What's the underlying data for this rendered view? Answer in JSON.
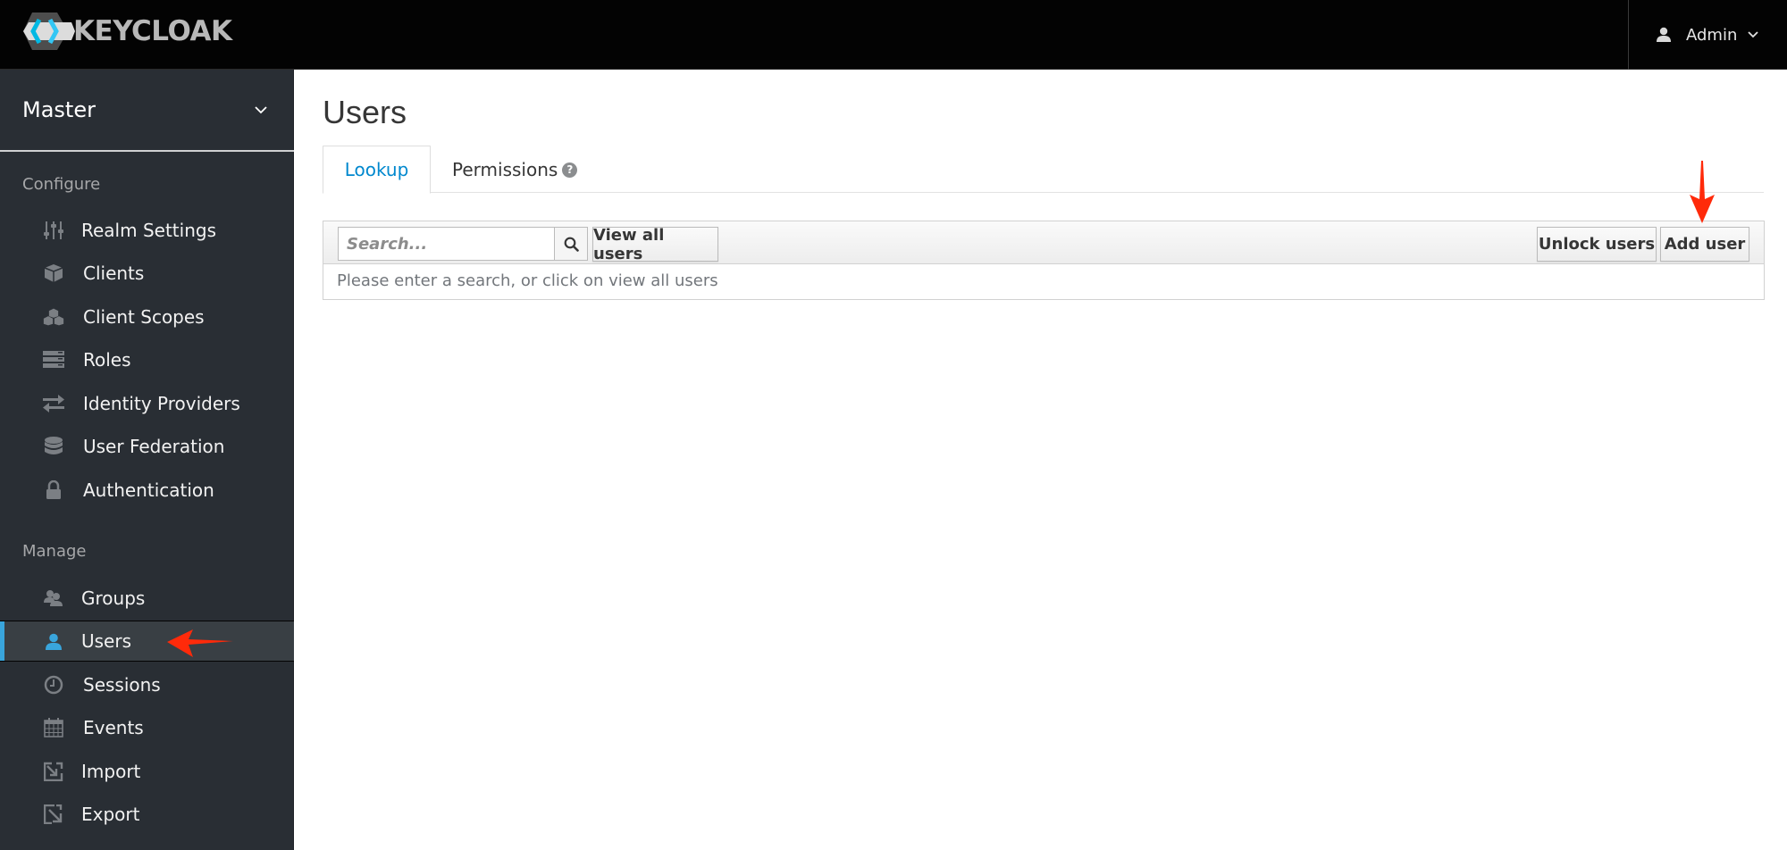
{
  "header": {
    "brand": "KEYCLOAK",
    "user_menu_label": "Admin",
    "icons": {
      "user": "user-icon",
      "caret": "chevron-down-icon"
    }
  },
  "sidebar": {
    "realm": {
      "name": "Master",
      "icon": "chevron-down-icon"
    },
    "sections": [
      {
        "label": "Configure",
        "items": [
          {
            "label": "Realm Settings",
            "icon": "sliders-icon",
            "active": false
          },
          {
            "label": "Clients",
            "icon": "cube-icon",
            "active": false
          },
          {
            "label": "Client Scopes",
            "icon": "cubes-icon",
            "active": false
          },
          {
            "label": "Roles",
            "icon": "server-icon",
            "active": false
          },
          {
            "label": "Identity Providers",
            "icon": "exchange-icon",
            "active": false
          },
          {
            "label": "User Federation",
            "icon": "database-icon",
            "active": false
          },
          {
            "label": "Authentication",
            "icon": "lock-icon",
            "active": false
          }
        ]
      },
      {
        "label": "Manage",
        "items": [
          {
            "label": "Groups",
            "icon": "users-icon",
            "active": false
          },
          {
            "label": "Users",
            "icon": "user-icon",
            "active": true
          },
          {
            "label": "Sessions",
            "icon": "clock-icon",
            "active": false
          },
          {
            "label": "Events",
            "icon": "calendar-icon",
            "active": false
          },
          {
            "label": "Import",
            "icon": "import-icon",
            "active": false
          },
          {
            "label": "Export",
            "icon": "export-icon",
            "active": false
          }
        ]
      }
    ]
  },
  "main": {
    "title": "Users",
    "tabs": [
      {
        "label": "Lookup",
        "active": true
      },
      {
        "label": "Permissions",
        "active": false,
        "help_icon": "question-circle-icon"
      }
    ],
    "toolbar": {
      "search_placeholder": "Search...",
      "search_value": "",
      "search_button_icon": "search-icon",
      "view_all_label": "View all users",
      "unlock_label": "Unlock users",
      "add_user_label": "Add user"
    },
    "empty_message": "Please enter a search, or click on view all users"
  },
  "annotations": [
    {
      "type": "arrow",
      "target": "sidebar-item-users",
      "color": "#ff2a0a"
    },
    {
      "type": "arrow",
      "target": "add-user-button",
      "color": "#ff2a0a"
    }
  ],
  "colors": {
    "header_bg": "#030303",
    "sidebar_bg": "#292e34",
    "active_accent": "#39a5dc",
    "link_blue": "#0088ce",
    "annotation_red": "#ff2a0a"
  }
}
